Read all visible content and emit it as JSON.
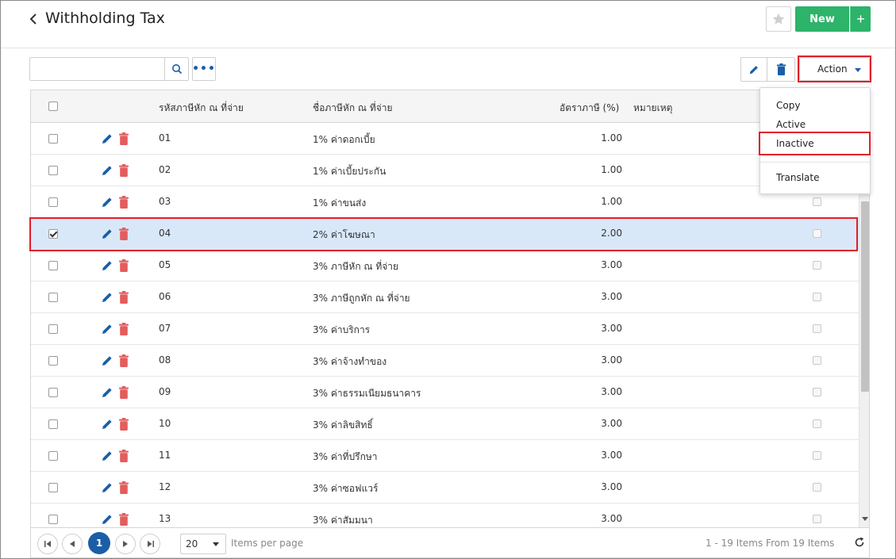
{
  "header": {
    "title": "Withholding Tax",
    "new_label": "New",
    "plus_label": "+"
  },
  "toolbar": {
    "search_value": "",
    "more_label": "•••",
    "action_label": "Action"
  },
  "grid": {
    "columns": {
      "code": "รหัสภาษีหัก ณ ที่จ่าย",
      "name": "ชื่อภาษีหัก ณ ที่จ่าย",
      "rate": "อัตราภาษี (%)",
      "remark": "หมายเหตุ"
    },
    "rows": [
      {
        "code": "01",
        "name": "1% ค่าดอกเบี้ย",
        "rate": "1.00",
        "checked": false
      },
      {
        "code": "02",
        "name": "1% ค่าเบี้ยประกัน",
        "rate": "1.00",
        "checked": false
      },
      {
        "code": "03",
        "name": "1% ค่าขนส่ง",
        "rate": "1.00",
        "checked": false
      },
      {
        "code": "04",
        "name": "2% ค่าโฆษณา",
        "rate": "2.00",
        "checked": true
      },
      {
        "code": "05",
        "name": "3% ภาษีหัก ณ ที่จ่าย",
        "rate": "3.00",
        "checked": false
      },
      {
        "code": "06",
        "name": "3% ภาษีถูกหัก ณ ที่จ่าย",
        "rate": "3.00",
        "checked": false
      },
      {
        "code": "07",
        "name": "3% ค่าบริการ",
        "rate": "3.00",
        "checked": false
      },
      {
        "code": "08",
        "name": "3% ค่าจ้างทำของ",
        "rate": "3.00",
        "checked": false
      },
      {
        "code": "09",
        "name": "3% ค่าธรรมเนียมธนาคาร",
        "rate": "3.00",
        "checked": false
      },
      {
        "code": "10",
        "name": "3% ค่าลิขสิทธิ์",
        "rate": "3.00",
        "checked": false
      },
      {
        "code": "11",
        "name": "3% ค่าที่ปรึกษา",
        "rate": "3.00",
        "checked": false
      },
      {
        "code": "12",
        "name": "3% ค่าซอฟแวร์",
        "rate": "3.00",
        "checked": false
      },
      {
        "code": "13",
        "name": "3% ค่าสัมมนา",
        "rate": "3.00",
        "checked": false
      }
    ]
  },
  "action_menu": {
    "items": [
      "Copy",
      "Active",
      "Inactive",
      "Translate"
    ]
  },
  "pager": {
    "current_page": "1",
    "page_size": "20",
    "items_per_page_label": "Items per page",
    "info": "1 - 19 Items From 19 Items"
  },
  "colors": {
    "primary": "#1a5ea8",
    "new_button": "#2db36a",
    "delete": "#e35d5d",
    "highlight": "#e0202a",
    "selected_row": "#d9e8f8"
  }
}
